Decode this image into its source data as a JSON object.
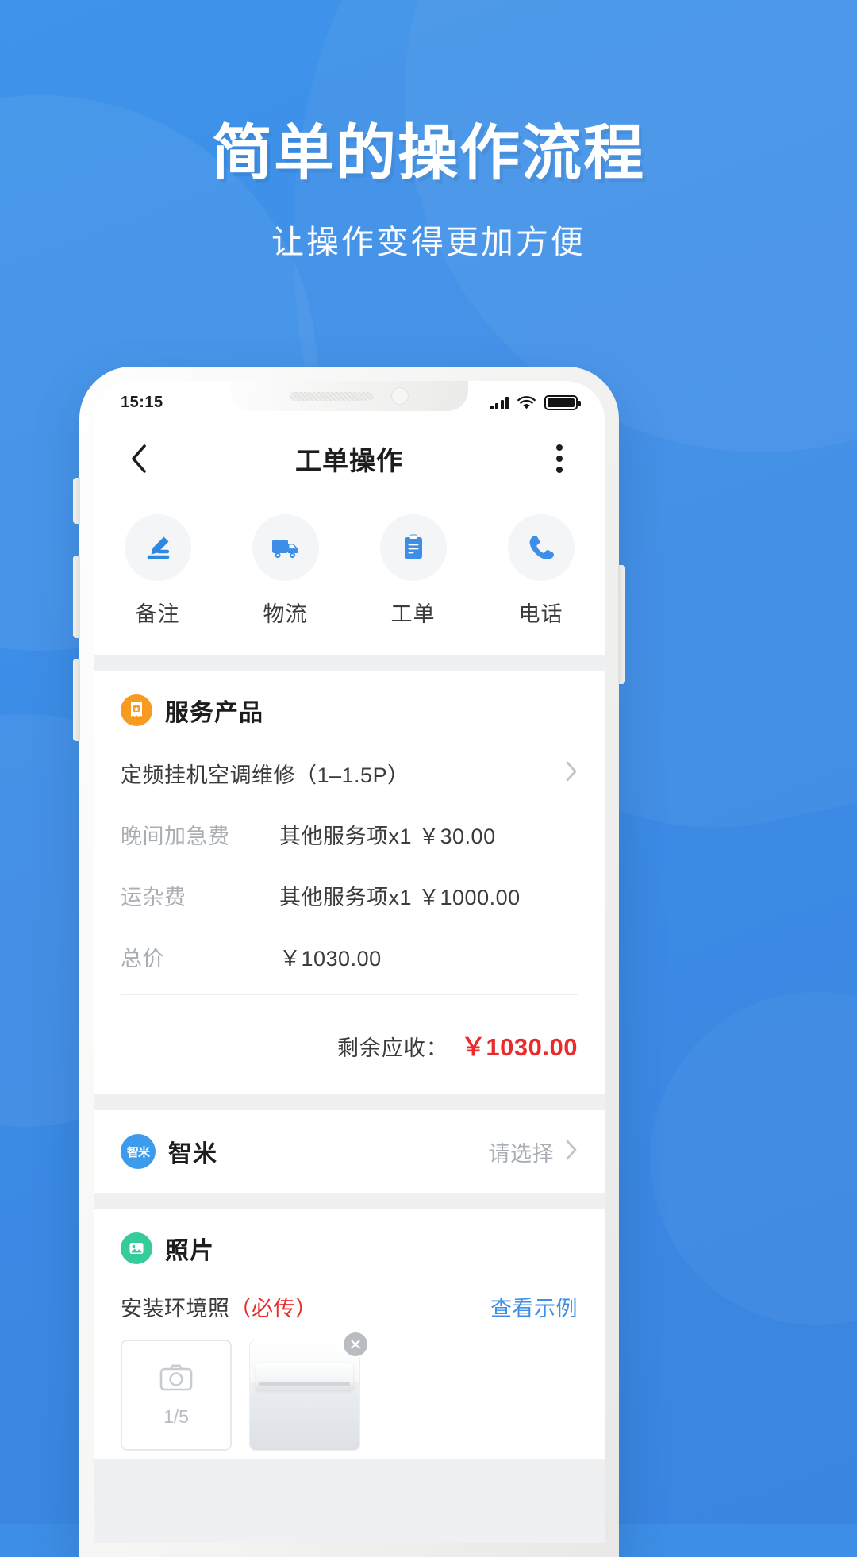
{
  "promo": {
    "headline": "简单的操作流程",
    "subhead": "让操作变得更加方便"
  },
  "status_bar": {
    "time": "15:15",
    "signal_icon": "signal-bars-icon",
    "wifi_icon": "wifi-icon",
    "battery_icon": "battery-full-icon"
  },
  "navbar": {
    "back_icon": "back-chevron-icon",
    "title": "工单操作",
    "more_icon": "more-vertical-icon"
  },
  "actions": [
    {
      "label": "备注",
      "icon": "edit-pen-icon"
    },
    {
      "label": "物流",
      "icon": "truck-icon"
    },
    {
      "label": "工单",
      "icon": "clipboard-icon"
    },
    {
      "label": "电话",
      "icon": "phone-icon"
    }
  ],
  "service_product": {
    "icon": "receipt-star-icon",
    "title": "服务产品",
    "product_name": "定频挂机空调维修（1–1.5P）",
    "fees": [
      {
        "label": "晚间加急费",
        "value": "其他服务项x1  ￥30.00"
      },
      {
        "label": "运杂费",
        "value": "其他服务项x1  ￥1000.00"
      },
      {
        "label": "总价",
        "value": "￥1030.00"
      }
    ],
    "remaining_label": "剩余应收：",
    "remaining_value": "￥1030.00",
    "remaining_color": "#ea2b2b"
  },
  "brand": {
    "badge_text": "智米",
    "name": "智米",
    "hint": "请选择",
    "chevron_icon": "chevron-right-icon"
  },
  "photos": {
    "icon": "image-icon",
    "title": "照片",
    "sub_label": "安装环境照",
    "required_tag": "（必传）",
    "example_link": "查看示例",
    "upload": {
      "icon": "camera-icon",
      "count": "1/5"
    },
    "thumbnail": {
      "alt": "air-conditioner-photo",
      "remove_icon": "close-icon"
    }
  },
  "theme": {
    "brand_blue": "#3d8ee6",
    "accent_orange": "#f79a1e",
    "accent_green": "#33cc9a",
    "danger_red": "#ea2b2b",
    "muted_gray": "#a9aeb4"
  }
}
